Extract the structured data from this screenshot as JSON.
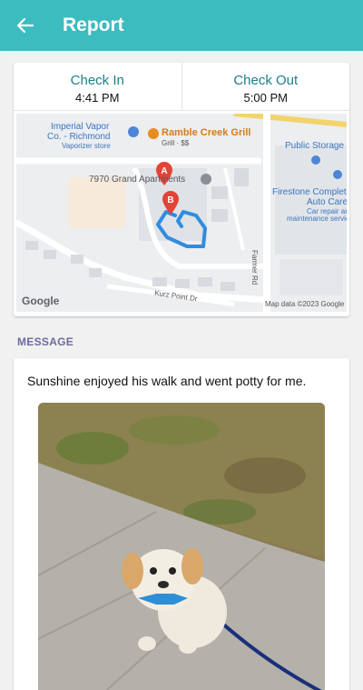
{
  "appbar": {
    "title": "Report",
    "back_icon": "arrow-left-icon"
  },
  "checks": {
    "check_in": {
      "label": "Check In",
      "time": "4:41 PM"
    },
    "check_out": {
      "label": "Check Out",
      "time": "5:00 PM"
    }
  },
  "map": {
    "places": {
      "imperial_vapor": "Imperial Vapor",
      "imperial_vapor_2": "Co. - Richmond",
      "imperial_vapor_sub": "Vaporizer store",
      "ramble_creek": "Ramble Creek Grill",
      "ramble_creek_sub": "Grill · $$",
      "grand_apartments": "7970 Grand Apartments",
      "public_storage": "Public Storage",
      "firestone": "Firestone Complete",
      "firestone_2": "Auto Care",
      "firestone_sub": "Car repair and",
      "firestone_sub_2": "maintenance service",
      "farmer_rd": "Farmer Rd",
      "kurz_point": "Kurz Point Dr"
    },
    "markers": {
      "a": "A",
      "b": "B"
    },
    "logo": "Google",
    "attribution": "Map data ©2023 Google",
    "colors": {
      "route": "#2f8ce0",
      "marker": "#e34438"
    }
  },
  "message": {
    "section_title": "MESSAGE",
    "text": "Sunshine enjoyed his walk and went potty for me.",
    "photo": "dog-photo"
  },
  "colors": {
    "accent": "#3cbcbf",
    "label": "#1d7f87",
    "section": "#6b6b9e"
  }
}
